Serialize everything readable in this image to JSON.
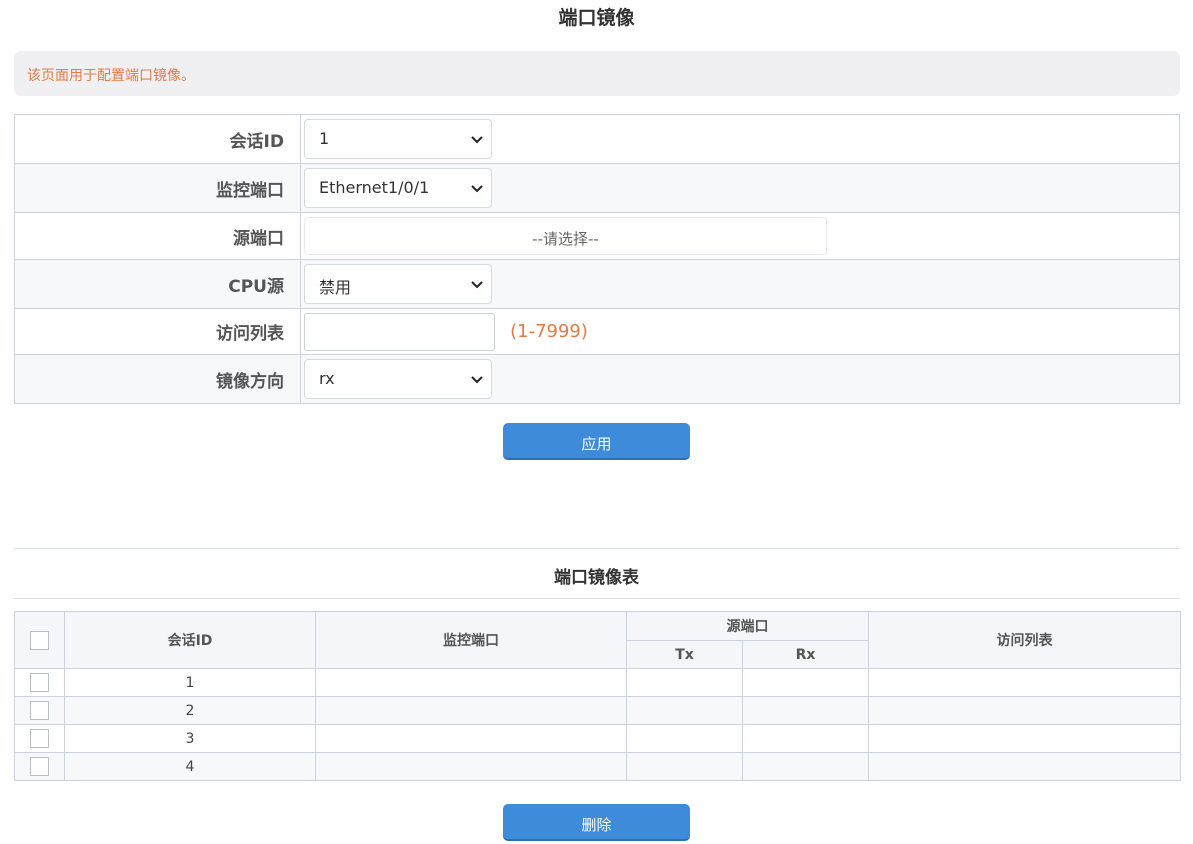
{
  "page": {
    "title": "端口镜像",
    "tip": "该页面用于配置端口镜像。"
  },
  "form": {
    "session_label": "会话ID",
    "session_value": "1",
    "monitor_label": "监控端口",
    "monitor_value": "Ethernet1/0/1",
    "source_label": "源端口",
    "source_placeholder": "--请选择--",
    "cpu_label": "CPU源",
    "cpu_value": "禁用",
    "acl_label": "访问列表",
    "acl_value": "",
    "acl_range": "(1-7999)",
    "direction_label": "镜像方向",
    "direction_value": "rx",
    "apply_label": "应用"
  },
  "table": {
    "title": "端口镜像表",
    "headers": {
      "session": "会话ID",
      "monitor": "监控端口",
      "source": "源端口",
      "tx": "Tx",
      "rx": "Rx",
      "acl": "访问列表"
    },
    "rows": [
      {
        "session": "1",
        "monitor": "",
        "tx": "",
        "rx": "",
        "acl": ""
      },
      {
        "session": "2",
        "monitor": "",
        "tx": "",
        "rx": "",
        "acl": ""
      },
      {
        "session": "3",
        "monitor": "",
        "tx": "",
        "rx": "",
        "acl": ""
      },
      {
        "session": "4",
        "monitor": "",
        "tx": "",
        "rx": "",
        "acl": ""
      }
    ],
    "delete_label": "删除"
  },
  "colors": {
    "accent": "#3d8bd9",
    "warning": "#e57a45",
    "border": "#c9d3e3"
  }
}
